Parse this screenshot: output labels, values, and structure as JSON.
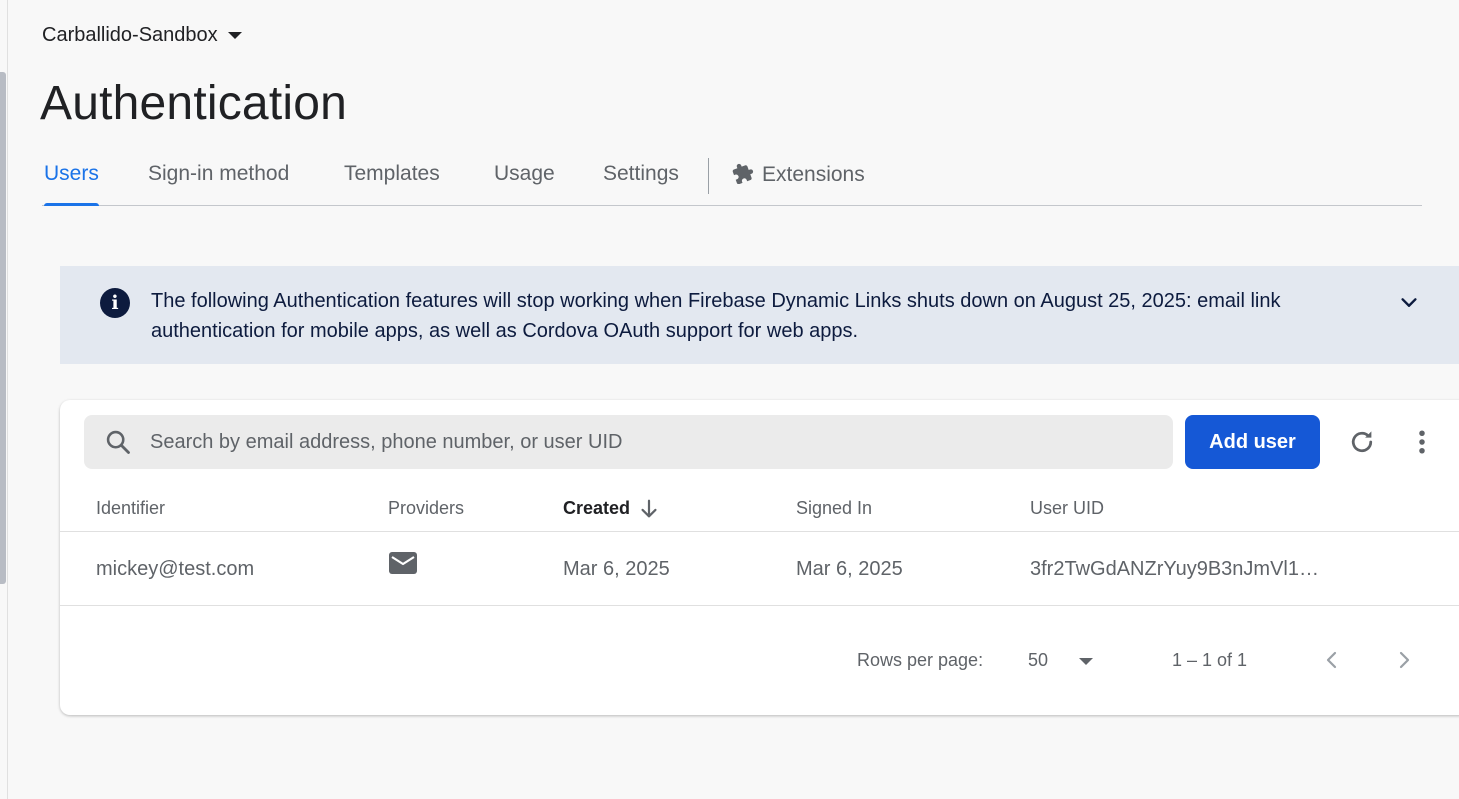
{
  "header": {
    "project_name": "Carballido-Sandbox",
    "page_title": "Authentication"
  },
  "tabs": [
    {
      "label": "Users",
      "active": true
    },
    {
      "label": "Sign-in method",
      "active": false
    },
    {
      "label": "Templates",
      "active": false
    },
    {
      "label": "Usage",
      "active": false
    },
    {
      "label": "Settings",
      "active": false
    },
    {
      "label": "Extensions",
      "active": false,
      "icon": "puzzle-piece-icon"
    }
  ],
  "banner": {
    "icon": "info-icon",
    "text": "The following Authentication features will stop working when Firebase Dynamic Links shuts down on August 25, 2025: email link authentication for mobile apps, as well as Cordova OAuth support for web apps."
  },
  "toolbar": {
    "search_placeholder": "Search by email address, phone number, or user UID",
    "search_value": "",
    "add_user_label": "Add user"
  },
  "table": {
    "columns": [
      "Identifier",
      "Providers",
      "Created",
      "Signed In",
      "User UID"
    ],
    "sorted_column": "Created",
    "sort_direction": "descending",
    "rows": [
      {
        "identifier": "mickey@test.com",
        "provider_icon": "email-icon",
        "created": "Mar 6, 2025",
        "signed_in": "Mar 6, 2025",
        "uid": "3fr2TwGdANZrYuy9B3nJmVl1…"
      }
    ]
  },
  "pagination": {
    "rows_per_page_label": "Rows per page:",
    "rows_per_page_value": "50",
    "range_label": "1 – 1 of 1"
  },
  "colors": {
    "accent": "#1a73e8",
    "primary_button": "#1558d6",
    "banner_bg": "#e3e8f0",
    "banner_text": "#0d1b3e",
    "page_bg": "#f8f8f8"
  }
}
